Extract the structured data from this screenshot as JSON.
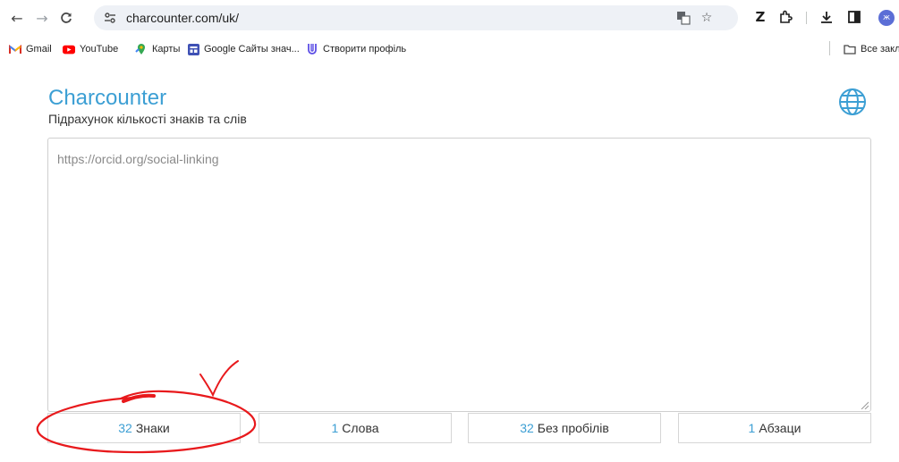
{
  "browser": {
    "url": "charcounter.com/uk/"
  },
  "bookmarks": [
    {
      "label": "Gmail",
      "icon": "gmail-icon"
    },
    {
      "label": "YouTube",
      "icon": "youtube-icon"
    },
    {
      "label": "Карты",
      "icon": "maps-icon"
    },
    {
      "label": "Google Сайты знач...",
      "icon": "google-sites-icon"
    },
    {
      "label": "Створити профіль",
      "icon": "profile-icon"
    },
    {
      "label": "Все закл",
      "icon": "folder-icon"
    }
  ],
  "page": {
    "title": "Charcounter",
    "subtitle": "Підрахунок кількості знаків та слів",
    "text_value": "https://orcid.org/social-linking"
  },
  "stats": [
    {
      "value": "32",
      "label": "Знаки"
    },
    {
      "value": "1",
      "label": "Слова"
    },
    {
      "value": "32",
      "label": "Без пробілів"
    },
    {
      "value": "1",
      "label": "Абзаци"
    }
  ],
  "colors": {
    "accent": "#3c9fd4",
    "annotation": "#e8191c"
  }
}
